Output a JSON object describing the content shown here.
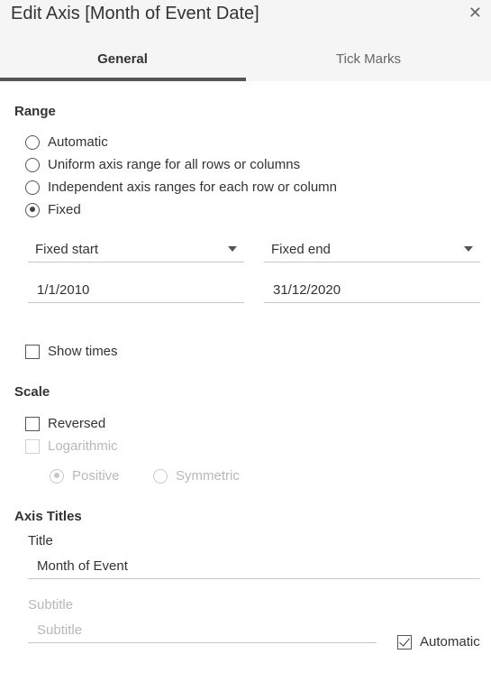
{
  "dialog": {
    "title": "Edit Axis [Month of Event Date]",
    "close_glyph": "✕"
  },
  "tabs": [
    {
      "label": "General",
      "selected": true
    },
    {
      "label": "Tick Marks",
      "selected": false
    }
  ],
  "range": {
    "heading": "Range",
    "options": [
      {
        "label": "Automatic",
        "checked": false
      },
      {
        "label": "Uniform axis range for all rows or columns",
        "checked": false
      },
      {
        "label": "Independent axis ranges for each row or column",
        "checked": false
      },
      {
        "label": "Fixed",
        "checked": true
      }
    ],
    "start_select": "Fixed start",
    "end_select": "Fixed end",
    "start_value": "1/1/2010",
    "end_value": "31/12/2020",
    "show_times_label": "Show times",
    "show_times_checked": false
  },
  "scale": {
    "heading": "Scale",
    "reversed_label": "Reversed",
    "reversed_checked": false,
    "logarithmic_label": "Logarithmic",
    "logarithmic_checked": false,
    "positive_label": "Positive",
    "positive_checked": true,
    "symmetric_label": "Symmetric",
    "symmetric_checked": false
  },
  "axis_titles": {
    "heading": "Axis Titles",
    "title_label": "Title",
    "title_value": "Month of Event",
    "subtitle_label": "Subtitle",
    "subtitle_placeholder": "Subtitle",
    "automatic_label": "Automatic",
    "automatic_checked": true
  }
}
